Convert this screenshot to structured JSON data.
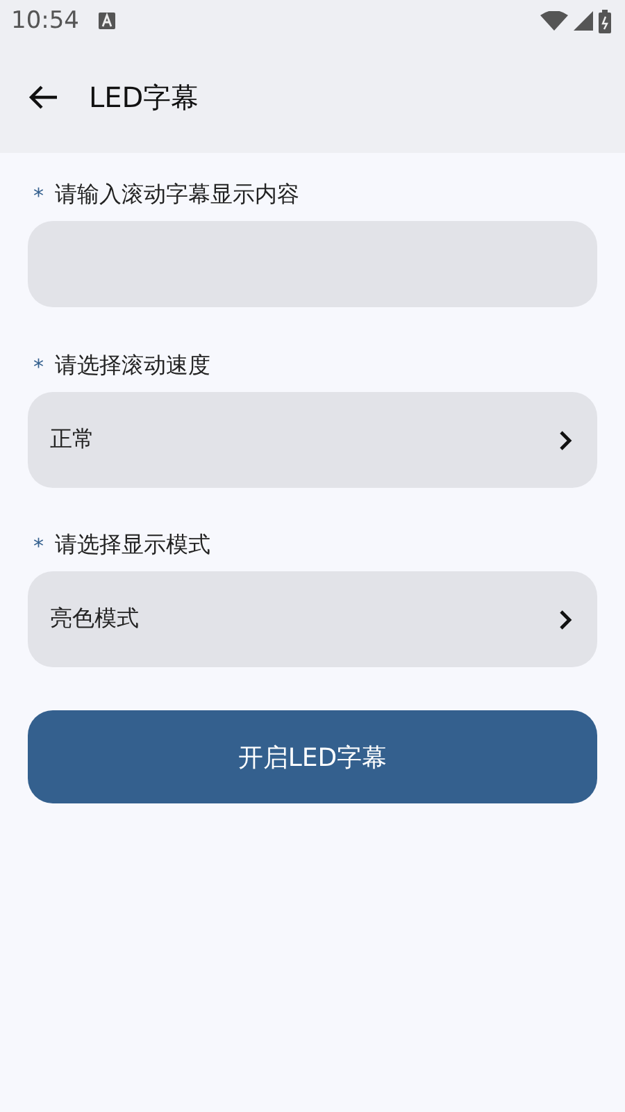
{
  "status_bar": {
    "time": "10:54"
  },
  "app_bar": {
    "title": "LED字幕"
  },
  "fields": [
    {
      "kind": "input",
      "required_mark": "*",
      "label": "请输入滚动字幕显示内容"
    },
    {
      "kind": "select",
      "required_mark": "*",
      "label": "请选择滚动速度",
      "value": "正常"
    },
    {
      "kind": "select",
      "required_mark": "*",
      "label": "请选择显示模式",
      "value": "亮色模式"
    }
  ],
  "button": {
    "label": "开启LED字幕"
  }
}
